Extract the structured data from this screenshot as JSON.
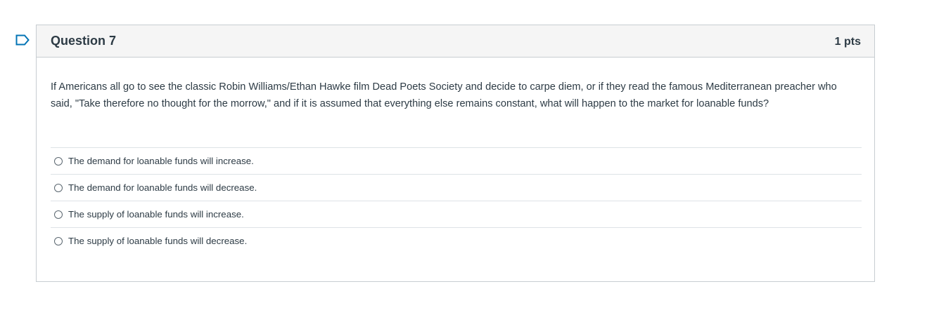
{
  "question": {
    "title": "Question 7",
    "points": "1 pts",
    "text": "If Americans all go to see the classic Robin Williams/Ethan Hawke film Dead Poets Society and decide to carpe diem, or if they read the famous Mediterranean preacher who said, \"Take therefore no thought for the morrow,\" and if it is assumed that everything else remains constant, what will happen to the market for loanable funds?",
    "flag_icon": "bookmark-flag-icon",
    "accent_color": "#0374b5",
    "answers": [
      {
        "label": "The demand for loanable funds will increase."
      },
      {
        "label": "The demand for loanable funds will decrease."
      },
      {
        "label": "The supply of loanable funds will increase."
      },
      {
        "label": "The supply of loanable funds will decrease."
      }
    ]
  }
}
